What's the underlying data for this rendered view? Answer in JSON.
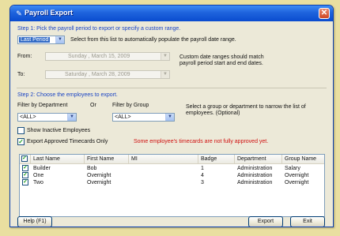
{
  "window": {
    "title": "Payroll Export"
  },
  "step1": {
    "heading": "Step 1: Pick the payroll period to export or specify a custom range.",
    "period_select": "Last Period",
    "period_hint": "Select from this list to automatically populate the payroll date range.",
    "from_label": "From:",
    "from_value": "Sunday  ,  March  15, 2009",
    "to_label": "To:",
    "to_value": "Saturday  ,  March  28, 2009",
    "range_note": "Custom date ranges should match payroll period start and end dates."
  },
  "step2": {
    "heading": "Step 2: Choose the employees to export.",
    "filter_dept_label": "Filter by Department",
    "or_label": "Or",
    "filter_group_label": "Filter by Group",
    "dept_value": "<ALL>",
    "group_value": "<ALL>",
    "filter_note": "Select a group or department to narrow the list of employees. (Optional)",
    "show_inactive_label": "Show Inactive Employees",
    "show_inactive_checked": false,
    "export_approved_label": "Export Approved Timecards Only",
    "export_approved_checked": true,
    "warning": "Some employee's timecards are not fully approved yet."
  },
  "table": {
    "columns": [
      "Last Name",
      "First Name",
      "MI",
      "Badge Num...",
      "Department",
      "Group Name"
    ],
    "rows": [
      {
        "checked": true,
        "last": "Builder",
        "first": "Bob",
        "mi": "",
        "badge": "1",
        "dept": "Administration",
        "group": "Salary"
      },
      {
        "checked": true,
        "last": "One",
        "first": "Overnight",
        "mi": "",
        "badge": "4",
        "dept": "Administration",
        "group": "Overnight"
      },
      {
        "checked": true,
        "last": "Two",
        "first": "Overnight",
        "mi": "",
        "badge": "3",
        "dept": "Administration",
        "group": "Overnight"
      }
    ]
  },
  "buttons": {
    "help": "Help (F1)",
    "export": "Export",
    "exit": "Exit"
  },
  "icons": {
    "title": "payroll-app-icon",
    "close": "close-icon",
    "dropdown": "chevron-down-icon",
    "check": "checkmark-icon"
  },
  "colors": {
    "title_bar": "#1e63dd",
    "step_text": "#1a44c4",
    "warning": "#d01010",
    "background": "#ece9d8"
  }
}
